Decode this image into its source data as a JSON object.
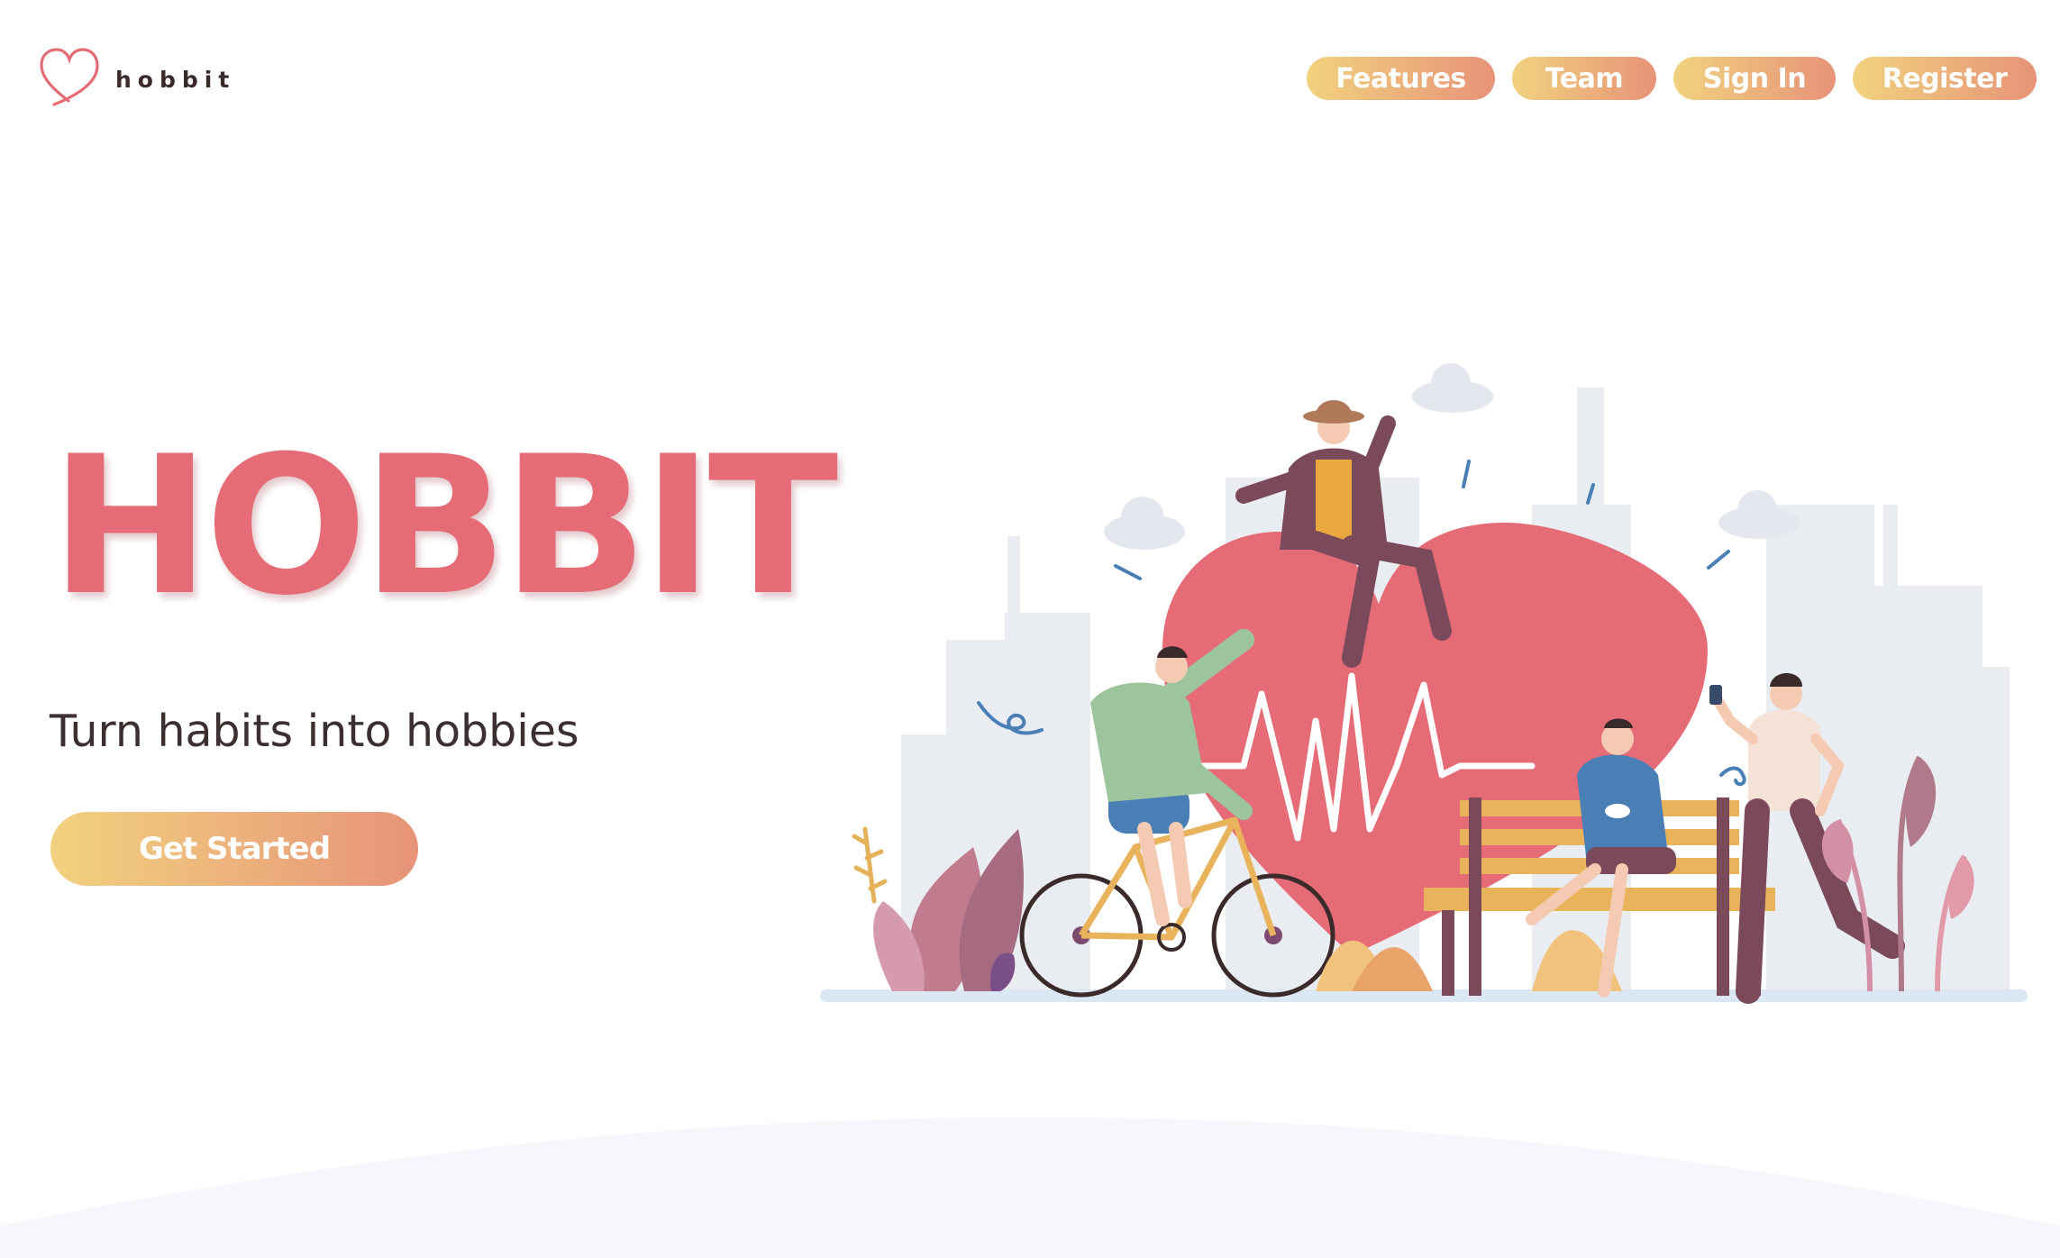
{
  "brand": {
    "name": "hobbit",
    "icon": "heart-outline-icon"
  },
  "nav": {
    "items": [
      {
        "label": "Features"
      },
      {
        "label": "Team"
      },
      {
        "label": "Sign In"
      },
      {
        "label": "Register"
      }
    ]
  },
  "hero": {
    "title": "HOBBIT",
    "subtitle": "Turn habits into hobbies",
    "cta_label": "Get Started",
    "illustration": "people-exercising-heart-illustration"
  },
  "colors": {
    "accent": "#e56c77",
    "gradient_start": "#f1d27f",
    "gradient_end": "#e79378",
    "text_dark": "#3b2f2f"
  }
}
